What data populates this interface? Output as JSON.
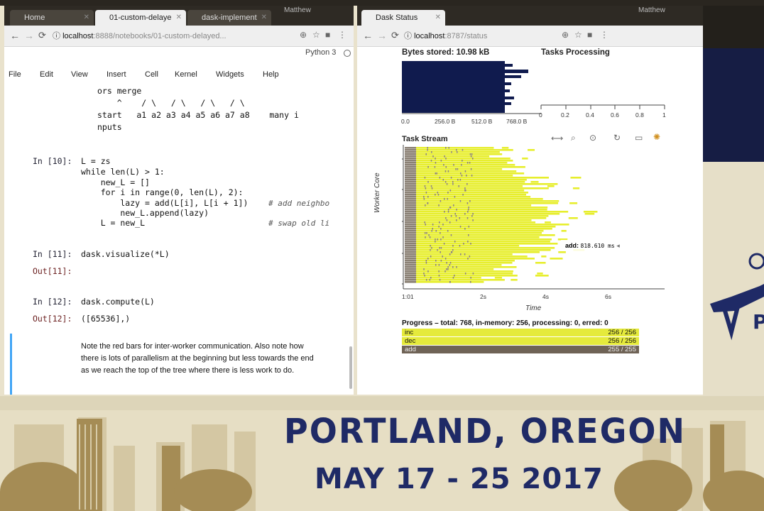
{
  "left_window": {
    "tabs": [
      {
        "label": "Home"
      },
      {
        "label": "01-custom-delaye"
      },
      {
        "label": "dask-implement"
      }
    ],
    "user": "Matthew",
    "url": {
      "host": "localhost",
      "path": ":8888/notebooks/01-custom-delayed..."
    },
    "kernel": "Python 3",
    "menu": [
      "File",
      "Edit",
      "View",
      "Insert",
      "Cell",
      "Kernel",
      "Widgets",
      "Help"
    ],
    "notebook": {
      "ascii_lines": [
        "ors merge",
        "    ^    / \\   / \\   / \\   / \\",
        "start   a1 a2 a3 a4 a5 a6 a7 a8    many i",
        "nputs"
      ],
      "cell10": {
        "prompt": "In [10]:",
        "lines": [
          "L = zs",
          "while len(L) > 1:",
          "    new_L = []",
          "    for i in range(0, len(L), 2):",
          "        lazy = add(L[i], L[i + 1])",
          "        new_L.append(lazy)",
          "    L = new_L"
        ],
        "comment1": "# add neighbo",
        "comment2": "# swap old li"
      },
      "cell11": {
        "in_prompt": "In [11]:",
        "code": "dask.visualize(*L)",
        "out_prompt": "Out[11]:"
      },
      "cell12": {
        "in_prompt": "In [12]:",
        "code": "dask.compute(L)",
        "out_prompt": "Out[12]:",
        "output": "([65536],)"
      },
      "markdown": "Note the red bars for inter-worker communication. Also note how there is lots of parallelism at the beginning but less towards the end as we reach the top of the tree where there is less work to do."
    }
  },
  "right_window": {
    "tabs": [
      {
        "label": "Dask Status"
      }
    ],
    "user": "Matthew",
    "url": {
      "host": "localhost",
      "path": ":8787/status"
    },
    "bytes_title": "Bytes stored: 10.98 kB",
    "tasks_title": "Tasks Processing",
    "bytes_ticks": [
      "0.0",
      "256.0 B",
      "512.0 B",
      "768.0 B"
    ],
    "tasks_ticks": [
      "0",
      "0.2",
      "0.4",
      "0.6",
      "0.8",
      "1"
    ],
    "stream_title": "Task Stream",
    "ylabel": "Worker Core",
    "xlabel": "Time",
    "time_ticks": [
      "1:01",
      "2s",
      "4s",
      "6s"
    ],
    "hover": {
      "name": "add:",
      "value": "818.610 ms"
    },
    "toolbar_icons": [
      "pan-icon",
      "zoom-icon",
      "wheel-zoom-icon",
      "reset-icon",
      "save-icon",
      "bokeh-logo-icon"
    ],
    "progress": {
      "header": "Progress – total: 768, in-memory: 256, processing: 0, erred: 0",
      "rows": [
        {
          "label": "inc",
          "value": "256 / 256",
          "color": "#e5ea3c"
        },
        {
          "label": "dec",
          "value": "256 / 256",
          "color": "#e5ea3c"
        },
        {
          "label": "add",
          "value": "255 / 255",
          "color": "#6f6356"
        }
      ]
    },
    "colors": {
      "bytes_bar": "#101b4e",
      "task_yellow": "#e7ee2d",
      "transfer_gray": "#8a8074"
    }
  },
  "poster": {
    "city": "PORTLAND, OREGON",
    "dates": "MAY 17 - 25 2017"
  }
}
